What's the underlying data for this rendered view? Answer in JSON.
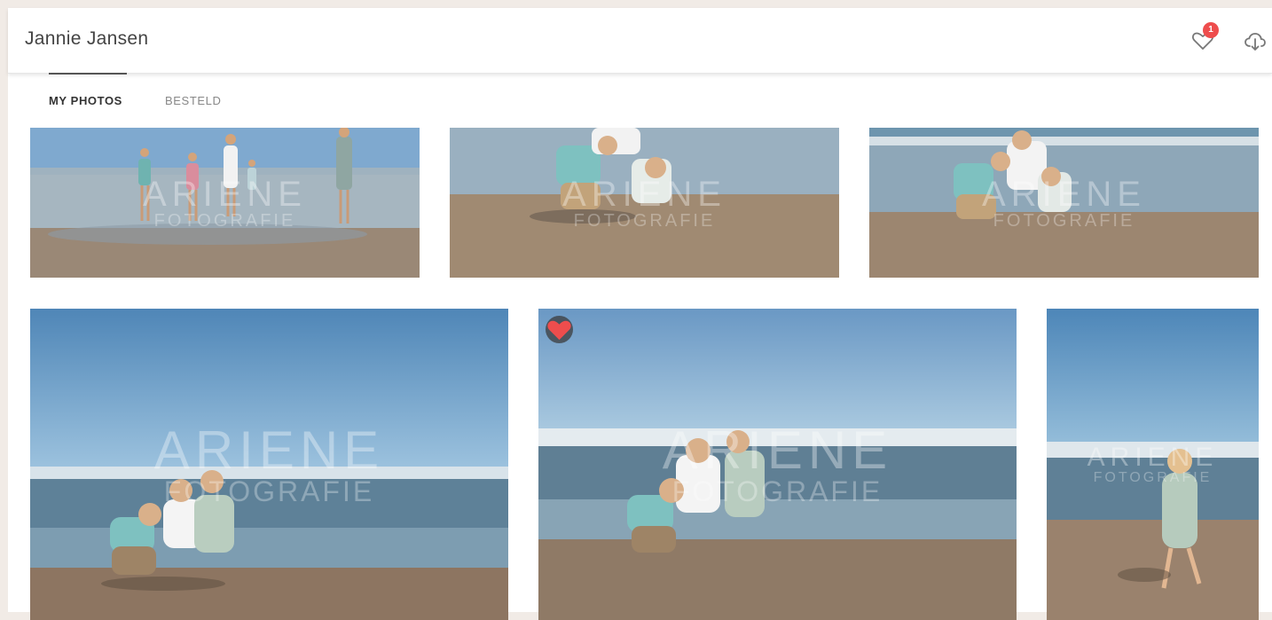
{
  "header": {
    "title": "Jannie Jansen",
    "favorites_count": "1",
    "favorites_icon": "heart-outline-icon",
    "download_icon": "cloud-download-icon",
    "badge_color": "#ee4d4d"
  },
  "tabs": [
    {
      "label": "MY PHOTOS",
      "active": true
    },
    {
      "label": "BESTELD",
      "active": false
    }
  ],
  "watermark": {
    "line1": "ARIENE",
    "line2": "FOTOGRAFIE"
  },
  "photos": [
    {
      "favorited": false
    },
    {
      "favorited": false
    },
    {
      "favorited": false
    },
    {
      "favorited": false
    },
    {
      "favorited": true
    },
    {
      "favorited": false
    }
  ]
}
